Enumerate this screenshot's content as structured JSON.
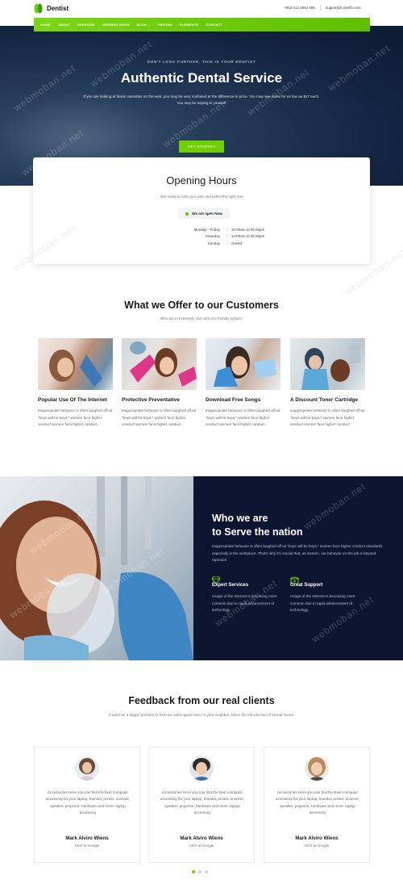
{
  "header": {
    "brand": "Dentist",
    "phone": "+953 012 3654 896",
    "email": "support@colorlib.com",
    "accent": "#6fd000"
  },
  "nav": [
    "HOME",
    "ABOUT",
    "SERVICES",
    "OPENING HOUR",
    "BLOG",
    "PRICING",
    "ELEMENTS",
    "CONTACT"
  ],
  "hero": {
    "eyebrow": "DON'T LOOK FURTHER, THIS IS YOUR DENTIST",
    "title": "Authentic Dental Service",
    "description": "If you are looking at blank cassettes on the web, you may be very confused at the difference in price. You may see some for as low as $17 each. You may be saying to yourself",
    "cta": "GET STARTED"
  },
  "opening_hours": {
    "title": "Opening Hours",
    "subtitle": "Get ready to cast your vote and select the right one",
    "status": "We are open Now",
    "rows": [
      {
        "day": "Monday - Friday",
        "time": "10:00am to 05:00pm"
      },
      {
        "day": "Saturday",
        "time": "12:00am to 05:00pm"
      },
      {
        "day": "Sunday",
        "time": "closed"
      }
    ]
  },
  "offer": {
    "title": "What we Offer to our Customers",
    "subtitle": "Who are in extremely love with eco friendly system.",
    "items": [
      {
        "title": "Popular Use Of The Internet",
        "text": "Inappropriate behavior is often laughed off as \"boys will be boys,\" women face higher conduct women face higher conduct."
      },
      {
        "title": "Protective Preventative",
        "text": "Inappropriate behavior is often laughed off as \"boys will be boys,\" women face higher conduct women face higher conduct."
      },
      {
        "title": "Download Free Songs",
        "text": "Inappropriate behavior is often laughed off as \"boys will be boys,\" women face higher conduct women face higher conduct."
      },
      {
        "title": "A Discount Toner Cartridge",
        "text": "Inappropriate behavior is often laughed off as \"boys will be boys,\" women face higher conduct women face higher conduct."
      }
    ]
  },
  "who": {
    "title_line1": "Who we are",
    "title_line2": "to Serve the nation",
    "description": "Inappropriate behavior is often laughed off as \"boys will be boys,\" women face higher conduct standards especially in the workplace. That's why it's crucial that, as women, our behavior on the job is beyond reproach.",
    "features": [
      {
        "icon": "diamond-icon",
        "title": "Expert Services",
        "text": "Usage of the Internet is becoming more common due to rapid advancement of technology."
      },
      {
        "icon": "phone-icon",
        "title": "Great Support",
        "text": "Usage of the Internet is becoming more common due to rapid advancement of technology."
      }
    ]
  },
  "feedback": {
    "title": "Feedback from our real clients",
    "subtitle": "It won't be a bigger problem to find one video game lover in your neighbor. Since the introduction of Virtual Game.",
    "items": [
      {
        "text": "Accessories Here you can find the best computer accessory for your laptop, monitor, printer, scanner, speaker, projector, hardware and more. laptop accessory",
        "name": "Mark Alviro Wiens",
        "role": "CEO at Google"
      },
      {
        "text": "Accessories Here you can find the best computer accessory for your laptop, monitor, printer, scanner, speaker, projector, hardware and more. laptop accessory",
        "name": "Mark Alviro Wiens",
        "role": "CEO at Google"
      },
      {
        "text": "Accessories Here you can find the best computer accessory for your laptop, monitor, printer, scanner, speaker, projector, hardware and more. laptop accessory",
        "name": "Mark Alviro Wiens",
        "role": "CEO at Google"
      }
    ]
  },
  "watermark": "webmoban.net"
}
